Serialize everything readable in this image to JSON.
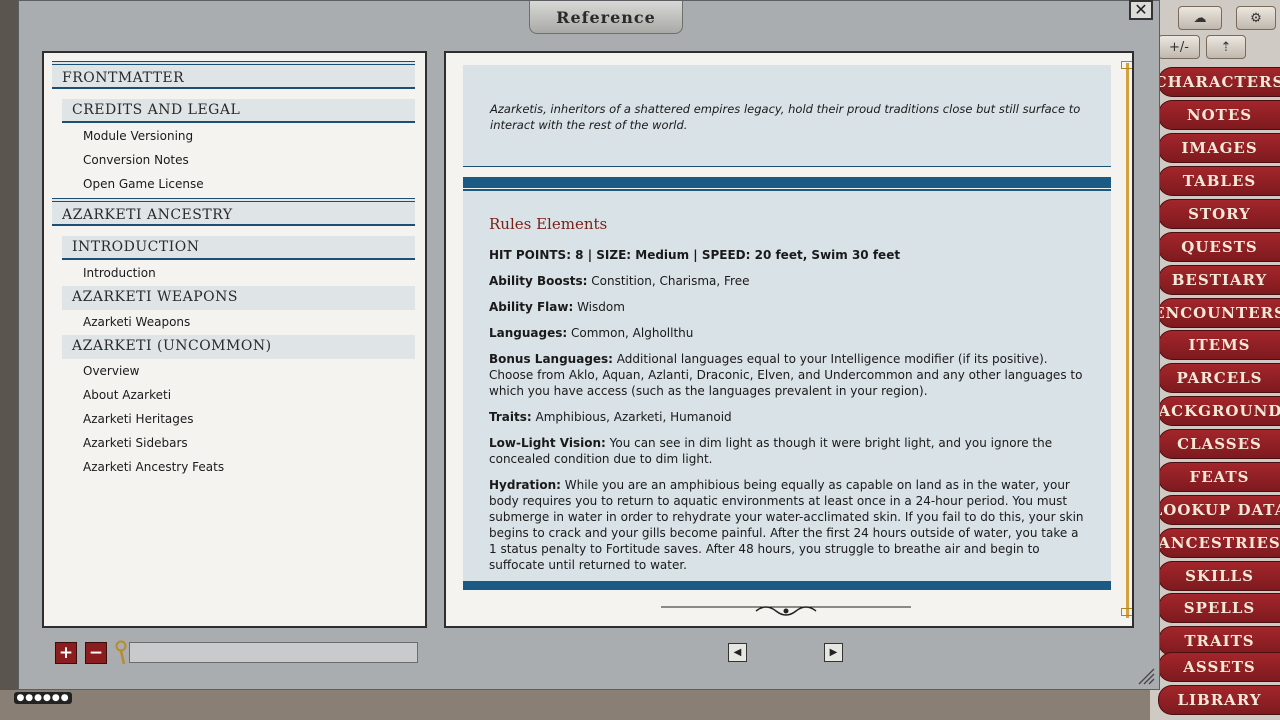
{
  "window": {
    "title": "Reference",
    "close_label": "✕"
  },
  "index": {
    "groups": [
      {
        "title": "Frontmatter",
        "subgroups": [
          {
            "title": "Credits and Legal",
            "items": [
              "Module Versioning",
              "Conversion Notes",
              "Open Game License"
            ]
          }
        ]
      },
      {
        "title": "Azarketi Ancestry",
        "subgroups": [
          {
            "title": "Introduction",
            "items": [
              "Introduction"
            ]
          },
          {
            "title": "Azarketi Weapons",
            "items": [
              "Azarketi Weapons"
            ]
          },
          {
            "title": "Azarketi (Uncommon)",
            "items": [
              "Overview",
              "About Azarketi",
              "Azarketi Heritages",
              "Azarketi Sidebars",
              "Azarketi Ancestry Feats"
            ]
          }
        ]
      }
    ]
  },
  "content": {
    "flavor_text": "Azarketis, inheritors of a shattered empires legacy, hold their proud traditions close but still surface to interact with the rest of the world.",
    "section_title": "Rules Elements",
    "stats_line": "HIT POINTS: 8 | SIZE: Medium | SPEED: 20 feet, Swim 30 feet",
    "entries": [
      {
        "label": "Ability Boosts:",
        "text": " Constition, Charisma, Free"
      },
      {
        "label": "Ability Flaw:",
        "text": " Wisdom"
      },
      {
        "label": "Languages:",
        "text": " Common, Alghollthu"
      },
      {
        "label": "Bonus Languages:",
        "text": " Additional languages equal to your Intelligence modifier (if its positive). Choose from Aklo, Aquan, Azlanti, Draconic, Elven, and Undercommon and any other languages to which you have access (such as the languages prevalent in your region)."
      },
      {
        "label": "Traits:",
        "text": " Amphibious, Azarketi, Humanoid"
      },
      {
        "label": "Low-Light Vision:",
        "text": " You can see in dim light as though it were bright light, and you ignore the concealed condition due to dim light."
      },
      {
        "label": "Hydration:",
        "text": " While you are an amphibious being equally as capable on land as in the water, your body requires you to return to aquatic environments at least once in a 24-hour period. You must submerge in water in order to rehydrate your water-acclimated skin. If you fail to do this, your skin begins to crack and your gills become painful. After the first 24 hours outside of water, you take a 1 status penalty to Fortitude saves. After 48 hours, you struggle to breathe air and begin to suffocate until returned to water."
      }
    ]
  },
  "toolbar": {
    "add_label": "+",
    "remove_label": "−",
    "search_value": "",
    "prev_label": "◀",
    "next_label": "▶"
  },
  "sidebar": {
    "top_buttons": [
      "+/-"
    ],
    "tabs": [
      "Characters",
      "Notes",
      "Images",
      "Tables",
      "Story",
      "Quests",
      "Bestiary",
      "Encounters",
      "Items",
      "Parcels",
      "Backgrounds",
      "Classes",
      "Feats",
      "Lookup Data",
      "Ancestries",
      "Skills",
      "Spells",
      "Traits",
      "Assets",
      "Library"
    ]
  },
  "colors": {
    "accent_blue": "#1b5a84",
    "tab_red": "#8b1d1f",
    "heading_red": "#7a1f18"
  }
}
